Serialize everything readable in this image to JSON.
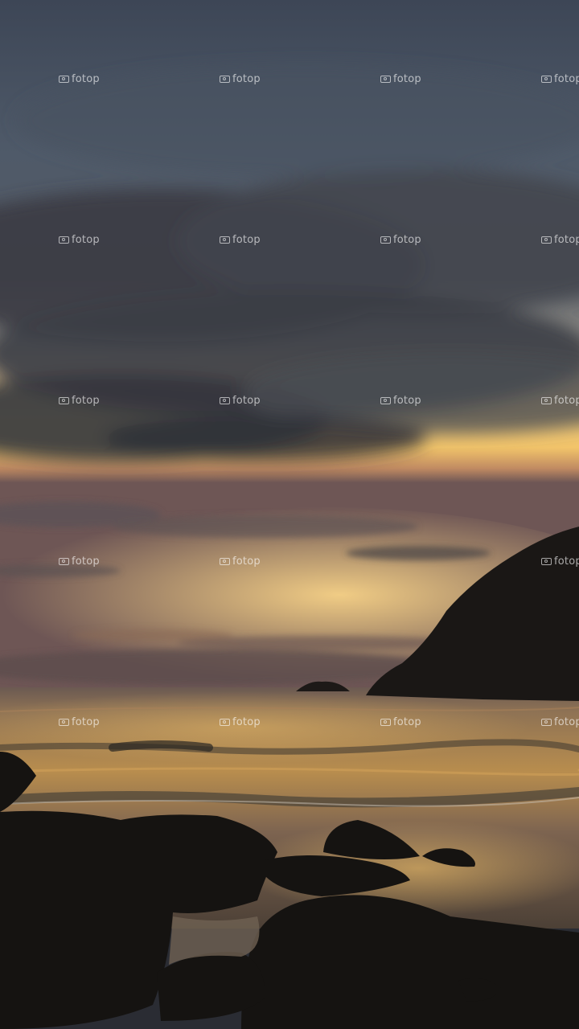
{
  "watermark": {
    "brand": "fotop",
    "icon": "camera-icon"
  },
  "colors": {
    "sky_top": "#3d4656",
    "cloud_dark": "#3b3d45",
    "horizon_glow": "#f2c46a",
    "headland": "#1a1715",
    "sea_reflection": "#d9a552",
    "rocks": "#151311"
  }
}
